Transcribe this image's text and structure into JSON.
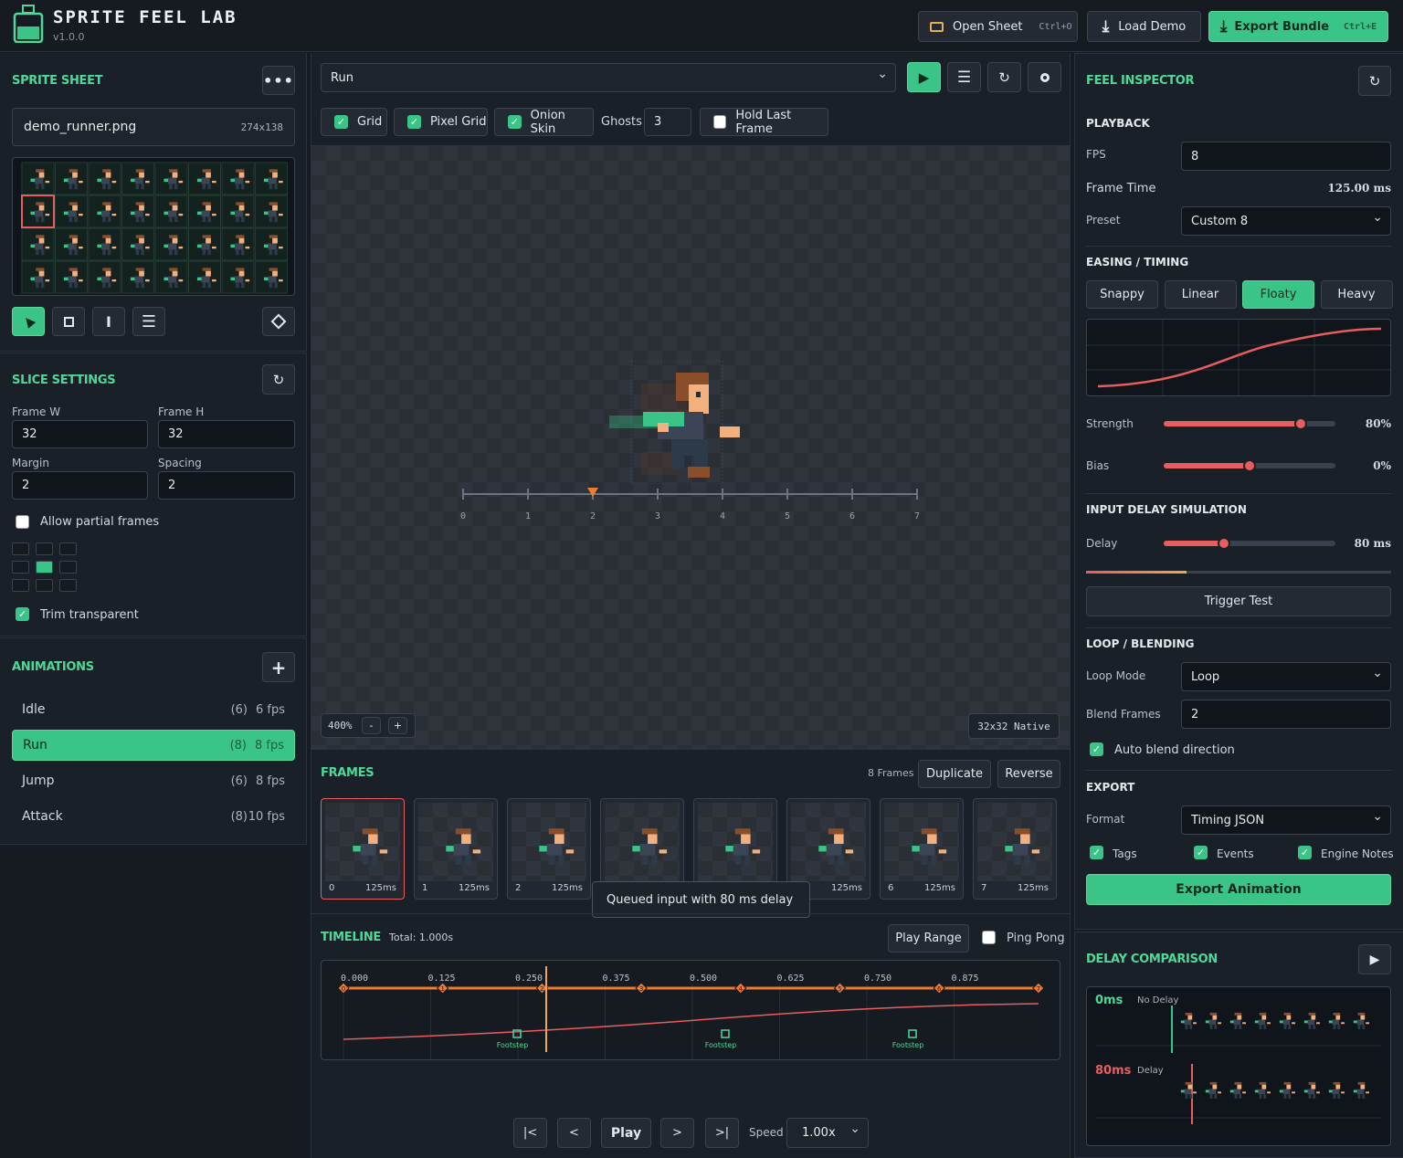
{
  "app": {
    "title": "SPRITE FEEL LAB",
    "version": "v1.0.0"
  },
  "header": {
    "open_sheet": "Open Sheet",
    "open_shortcut": "Ctrl+O",
    "load_demo": "Load Demo",
    "export_bundle": "Export Bundle",
    "export_shortcut": "Ctrl+E"
  },
  "sprite_sheet": {
    "title": "SPRITE SHEET",
    "file_name": "demo_runner.png",
    "dimensions": "274x138",
    "selected_cell": {
      "row": 2,
      "col": 1
    }
  },
  "slice": {
    "title": "SLICE SETTINGS",
    "frame_w_label": "Frame W",
    "frame_w": "32",
    "frame_h_label": "Frame H",
    "frame_h": "32",
    "margin_label": "Margin",
    "margin": "2",
    "spacing_label": "Spacing",
    "spacing": "2",
    "allow_partial": "Allow partial frames",
    "trim_transparent": "Trim transparent"
  },
  "animations": {
    "title": "ANIMATIONS",
    "items": [
      {
        "name": "Idle",
        "count": "(6)",
        "fps": "6 fps"
      },
      {
        "name": "Run",
        "count": "(8)",
        "fps": "8 fps"
      },
      {
        "name": "Jump",
        "count": "(6)",
        "fps": "8 fps"
      },
      {
        "name": "Attack",
        "count": "(8)",
        "fps": "10 fps"
      }
    ],
    "selected": "Run"
  },
  "viewport": {
    "animation_select": "Run",
    "grid": "Grid",
    "pixel_grid": "Pixel Grid",
    "onion_skin": "Onion Skin",
    "ghosts_label": "Ghosts",
    "ghosts": "3",
    "hold_last": "Hold Last Frame",
    "ruler_ticks": [
      "0",
      "1",
      "2",
      "3",
      "4",
      "5",
      "6",
      "7"
    ],
    "zoom": "400%",
    "zoom_minus": "-",
    "zoom_plus": "+",
    "native": "32x32 Native"
  },
  "frames": {
    "title": "FRAMES",
    "count_text": "8 Frames",
    "duplicate": "Duplicate",
    "reverse": "Reverse",
    "items": [
      {
        "index": "0",
        "ms": "125ms"
      },
      {
        "index": "1",
        "ms": "125ms"
      },
      {
        "index": "2",
        "ms": "125ms"
      },
      {
        "index": "3",
        "ms": "125ms"
      },
      {
        "index": "4",
        "ms": "125ms"
      },
      {
        "index": "5",
        "ms": "125ms"
      },
      {
        "index": "6",
        "ms": "125ms"
      },
      {
        "index": "7",
        "ms": "125ms"
      }
    ],
    "tooltip": "Queued input with 80 ms delay"
  },
  "timeline": {
    "title": "TIMELINE",
    "total": "Total: 1.000s",
    "play_range": "Play Range",
    "ping_pong": "Ping Pong",
    "ticks": [
      "0.000",
      "0.125",
      "0.250",
      "0.375",
      "0.500",
      "0.625",
      "0.750",
      "0.875"
    ],
    "keys": [
      "0",
      "1",
      "2",
      "3",
      "4",
      "5",
      "6",
      "7"
    ],
    "events": [
      "Footstep",
      "Footstep",
      "Footstep"
    ]
  },
  "transport": {
    "first": "|<",
    "prev": "<",
    "play": "Play",
    "next": ">",
    "last": ">|",
    "speed_label": "Speed",
    "speed": "1.00x"
  },
  "inspector": {
    "title": "FEEL INSPECTOR",
    "playback": "PLAYBACK",
    "fps_label": "FPS",
    "fps": "8",
    "frame_time_label": "Frame Time",
    "frame_time": "125.00 ms",
    "preset_label": "Preset",
    "preset": "Custom 8",
    "easing": "EASING / TIMING",
    "easing_options": [
      "Snappy",
      "Linear",
      "Floaty",
      "Heavy"
    ],
    "easing_selected": "Floaty",
    "strength_label": "Strength",
    "strength": "80%",
    "strength_value": 0.8,
    "bias_label": "Bias",
    "bias": "0%",
    "bias_value": 0.5,
    "input_delay": "INPUT DELAY SIMULATION",
    "delay_label": "Delay",
    "delay": "80 ms",
    "delay_value": 0.35,
    "delay_progress": 0.33,
    "trigger": "Trigger Test",
    "loop": "LOOP / BLENDING",
    "loop_mode_label": "Loop Mode",
    "loop_mode": "Loop",
    "blend_label": "Blend Frames",
    "blend": "2",
    "auto_blend": "Auto blend direction",
    "export": "EXPORT",
    "format_label": "Format",
    "format": "Timing JSON",
    "tags": "Tags",
    "events": "Events",
    "engine_notes": "Engine Notes",
    "export_anim": "Export Animation"
  },
  "delay_comparison": {
    "title": "DELAY COMPARISON",
    "row1_ms": "0ms",
    "row1_label": "No Delay",
    "row2_ms": "80ms",
    "row2_label": "Delay"
  },
  "colors": {
    "accent": "#3bc487",
    "accent_text": "#4fd89a",
    "curve": "#e85d5d",
    "timeline_orange": "#f07a32"
  }
}
